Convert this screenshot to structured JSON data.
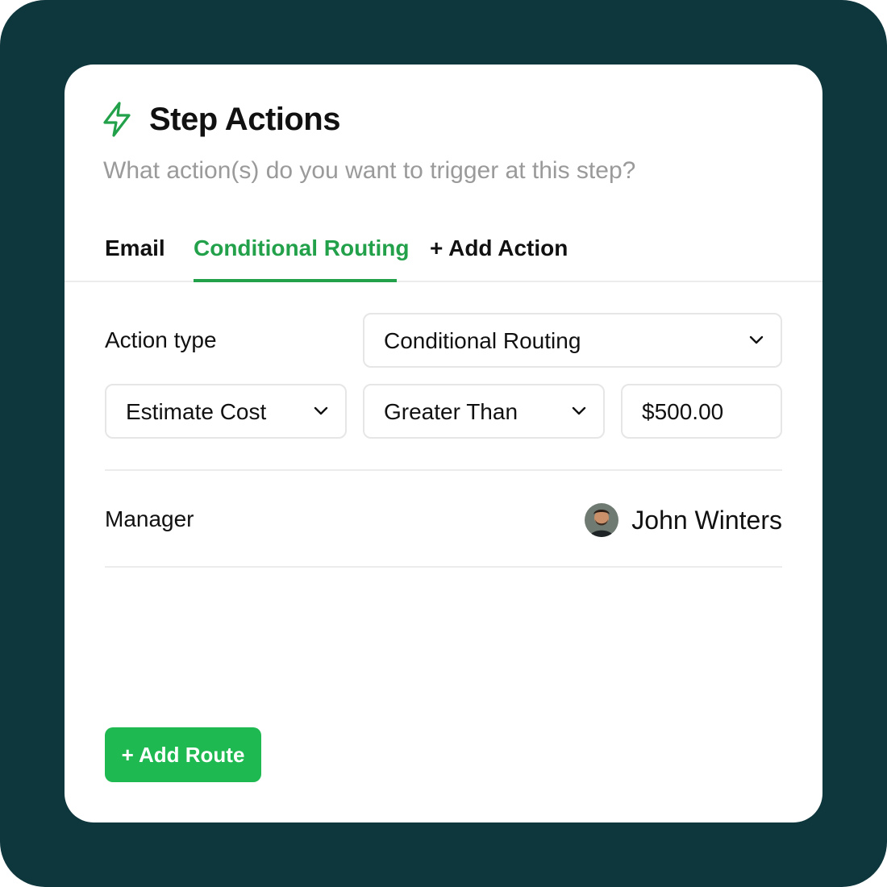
{
  "header": {
    "icon": "lightning-bolt-icon",
    "title": "Step Actions",
    "subtitle": "What action(s) do you want to trigger at this step?"
  },
  "tabs": [
    {
      "label": "Email",
      "active": false
    },
    {
      "label": "Conditional Routing",
      "active": true
    },
    {
      "label": "+ Add Action",
      "active": false
    }
  ],
  "action_type": {
    "label": "Action type",
    "value": "Conditional Routing"
  },
  "condition": {
    "field": "Estimate Cost",
    "operator": "Greater Than",
    "amount": "$500.00"
  },
  "manager": {
    "label": "Manager",
    "name": "John Winters",
    "avatar_icon": "avatar"
  },
  "add_route_label": "+ Add Route",
  "colors": {
    "frame_bg": "#0e363d",
    "accent": "#22a14a",
    "button": "#1fb952",
    "subtitle": "#9a9a9a"
  }
}
